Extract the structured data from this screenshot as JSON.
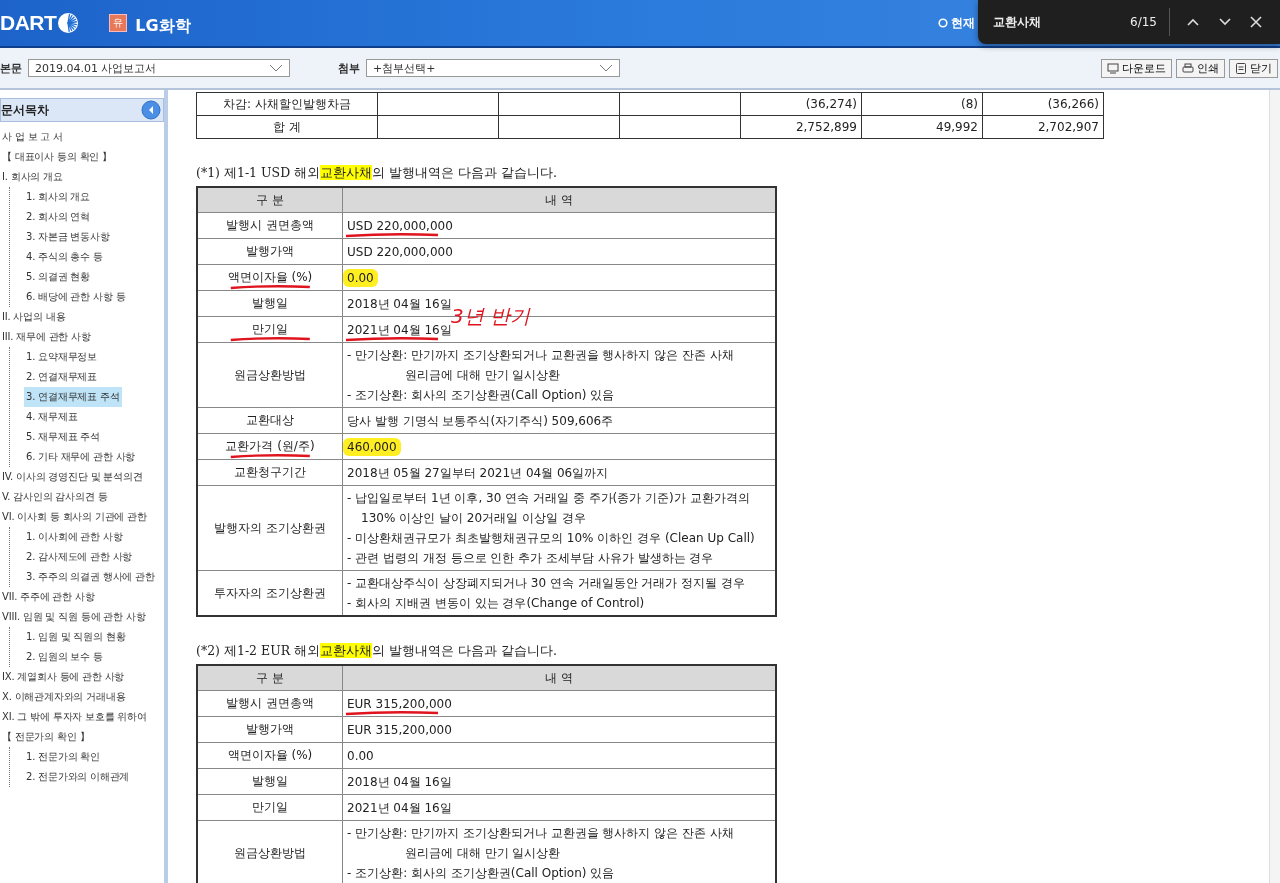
{
  "header": {
    "logo": "DART",
    "company_badge": "유",
    "company": "LG화학",
    "status_link": "현재"
  },
  "find_bar": {
    "query": "교환사채",
    "count": "6/15"
  },
  "toolbar": {
    "main_label": "본문",
    "main_value": "2019.04.01  사업보고서",
    "attach_label": "첨부",
    "attach_value": "+첨부선택+",
    "buttons": [
      {
        "kind": "download",
        "label": "다운로드"
      },
      {
        "kind": "print",
        "label": "인쇄"
      },
      {
        "kind": "close",
        "label": "닫기"
      }
    ]
  },
  "sidebar": {
    "title": "문서목차",
    "items": [
      {
        "label": "사 업 보 고 서",
        "selected": false
      },
      {
        "label": "【 대표이사 등의 확인 】",
        "selected": false
      },
      {
        "label": "I. 회사의 개요",
        "selected": false,
        "children": [
          {
            "label": "1. 회사의 개요",
            "selected": false
          },
          {
            "label": "2. 회사의 연혁",
            "selected": false
          },
          {
            "label": "3. 자본금 변동사항",
            "selected": false
          },
          {
            "label": "4. 주식의 총수 등",
            "selected": false
          },
          {
            "label": "5. 의결권 현황",
            "selected": false
          },
          {
            "label": "6. 배당에 관한 사항 등",
            "selected": false
          }
        ]
      },
      {
        "label": "II. 사업의 내용",
        "selected": false
      },
      {
        "label": "III. 재무에 관한 사항",
        "selected": false,
        "children": [
          {
            "label": "1. 요약재무정보",
            "selected": false
          },
          {
            "label": "2. 연결재무제표",
            "selected": false
          },
          {
            "label": "3. 연결재무제표 주석",
            "selected": true
          },
          {
            "label": "4. 재무제표",
            "selected": false
          },
          {
            "label": "5. 재무제표 주석",
            "selected": false
          },
          {
            "label": "6. 기타 재무에 관한 사항",
            "selected": false
          }
        ]
      },
      {
        "label": "IV. 이사의 경영진단 및 분석의견",
        "selected": false
      },
      {
        "label": "V. 감사인의 감사의견 등",
        "selected": false
      },
      {
        "label": "VI. 이사회 등 회사의 기관에 관한",
        "selected": false,
        "children": [
          {
            "label": "1. 이사회에 관한 사항",
            "selected": false
          },
          {
            "label": "2. 감사제도에 관한 사항",
            "selected": false
          },
          {
            "label": "3. 주주의 의결권 행사에 관한",
            "selected": false
          }
        ]
      },
      {
        "label": "VII. 주주에 관한 사항",
        "selected": false
      },
      {
        "label": "VIII. 임원 및 직원 등에 관한 사항",
        "selected": false,
        "children": [
          {
            "label": "1. 임원 및 직원의 현황",
            "selected": false
          },
          {
            "label": "2. 임원의 보수 등",
            "selected": false
          }
        ]
      },
      {
        "label": "IX. 계열회사 등에 관한 사항",
        "selected": false
      },
      {
        "label": "X. 이해관계자와의 거래내용",
        "selected": false
      },
      {
        "label": "XI. 그 밖에 투자자 보호를 위하여",
        "selected": false
      },
      {
        "label": "【 전문가의 확인 】",
        "selected": false,
        "children": [
          {
            "label": "1. 전문가의 확인",
            "selected": false
          },
          {
            "label": "2. 전문가와의 이해관계",
            "selected": false
          }
        ]
      }
    ]
  },
  "summary_table": {
    "rows": [
      {
        "cells": [
          "차감: 사채할인발행차금",
          "",
          "",
          "",
          "(36,274)",
          "(8)",
          "(36,266)"
        ]
      },
      {
        "cells": [
          "합      계",
          "",
          "",
          "",
          "2,752,899",
          "49,992",
          "2,702,907"
        ]
      }
    ]
  },
  "sections": [
    {
      "title_before": "(*1) 제1-1 USD 해외",
      "title_match": "교환사채",
      "title_after": "의 발행내역은 다음과 같습니다.",
      "columns": [
        "구 분",
        "내 역"
      ],
      "rows": [
        {
          "label": "발행시 권면총액",
          "lines": [
            {
              "kind": "line",
              "text": "USD 220,000,000"
            }
          ],
          "label_underline": false,
          "value_underline": true,
          "highlight": false
        },
        {
          "label": "발행가액",
          "lines": [
            {
              "kind": "line",
              "text": "USD 220,000,000"
            }
          ],
          "label_underline": false,
          "value_underline": false,
          "highlight": false
        },
        {
          "label": "액면이자율 (%)",
          "lines": [
            {
              "kind": "line",
              "text": "0.00"
            }
          ],
          "label_underline": true,
          "value_underline": false,
          "highlight": true
        },
        {
          "label": "발행일",
          "lines": [
            {
              "kind": "line",
              "text": "2018년 04월 16일"
            }
          ],
          "label_underline": false,
          "value_underline": false,
          "highlight": false
        },
        {
          "label": "만기일",
          "lines": [
            {
              "kind": "line",
              "text": "2021년 04월 16일"
            }
          ],
          "label_underline": true,
          "value_underline": true,
          "highlight": false,
          "note": "3년 반기"
        },
        {
          "label": "원금상환방법",
          "lines": [
            {
              "kind": "line",
              "text": "- 만기상환: 만기까지 조기상환되거나 교환권을 행사하지 않은 잔존 사채"
            },
            {
              "kind": "deep",
              "text": "원리금에 대해 만기 일시상환"
            },
            {
              "kind": "line",
              "text": "- 조기상환: 회사의 조기상환권(Call Option) 있음"
            }
          ],
          "label_underline": false,
          "value_underline": false,
          "highlight": false
        },
        {
          "label": "교환대상",
          "lines": [
            {
              "kind": "line",
              "text": "당사 발행 기명식 보통주식(자기주식) 509,606주"
            }
          ],
          "label_underline": false,
          "value_underline": false,
          "highlight": false
        },
        {
          "label": "교환가격 (원/주)",
          "lines": [
            {
              "kind": "line",
              "text": "460,000"
            }
          ],
          "label_underline": true,
          "value_underline": false,
          "highlight": true
        },
        {
          "label": "교환청구기간",
          "lines": [
            {
              "kind": "line",
              "text": "2018년 05월 27일부터 2021년 04월 06일까지"
            }
          ],
          "label_underline": false,
          "value_underline": false,
          "highlight": false
        },
        {
          "label": "발행자의 조기상환권",
          "lines": [
            {
              "kind": "line",
              "text": "- 납입일로부터 1년 이후, 30 연속 거래일 중 주가(종가 기준)가 교환가격의"
            },
            {
              "kind": "wrap",
              "text": "130% 이상인 날이 20거래일 이상일 경우"
            },
            {
              "kind": "line",
              "text": "- 미상환채권규모가 최초발행채권규모의 10% 이하인 경우 (Clean Up Call)"
            },
            {
              "kind": "line",
              "text": "- 관련 법령의 개정 등으로 인한 추가 조세부담 사유가 발생하는 경우"
            }
          ],
          "label_underline": false,
          "value_underline": false,
          "highlight": false
        },
        {
          "label": "투자자의 조기상환권",
          "lines": [
            {
              "kind": "line",
              "text": "- 교환대상주식이 상장폐지되거나 30 연속 거래일동안 거래가 정지될 경우"
            },
            {
              "kind": "line",
              "text": "- 회사의 지배권 변동이 있는 경우(Change of Control)"
            }
          ],
          "label_underline": false,
          "value_underline": false,
          "highlight": false
        }
      ]
    },
    {
      "title_before": "(*2) 제1-2 EUR 해외",
      "title_match": "교환사채",
      "title_after": "의 발행내역은 다음과 같습니다.",
      "columns": [
        "구 분",
        "내 역"
      ],
      "rows": [
        {
          "label": "발행시 권면총액",
          "lines": [
            {
              "kind": "line",
              "text": "EUR 315,200,000"
            }
          ],
          "label_underline": false,
          "value_underline": true,
          "highlight": false
        },
        {
          "label": "발행가액",
          "lines": [
            {
              "kind": "line",
              "text": "EUR 315,200,000"
            }
          ],
          "label_underline": false,
          "value_underline": false,
          "highlight": false
        },
        {
          "label": "액면이자율 (%)",
          "lines": [
            {
              "kind": "line",
              "text": "0.00"
            }
          ],
          "label_underline": false,
          "value_underline": false,
          "highlight": false
        },
        {
          "label": "발행일",
          "lines": [
            {
              "kind": "line",
              "text": "2018년 04월 16일"
            }
          ],
          "label_underline": false,
          "value_underline": false,
          "highlight": false
        },
        {
          "label": "만기일",
          "lines": [
            {
              "kind": "line",
              "text": "2021년 04월 16일"
            }
          ],
          "label_underline": false,
          "value_underline": false,
          "highlight": false
        },
        {
          "label": "원금상환방법",
          "lines": [
            {
              "kind": "line",
              "text": "- 만기상환: 만기까지 조기상환되거나 교환권을 행사하지 않은 잔존 사채"
            },
            {
              "kind": "deep",
              "text": "원리금에 대해 만기 일시상환"
            },
            {
              "kind": "line",
              "text": "- 조기상환: 회사의 조기상환권(Call Option) 있음"
            }
          ],
          "label_underline": false,
          "value_underline": false,
          "highlight": false
        }
      ]
    }
  ]
}
